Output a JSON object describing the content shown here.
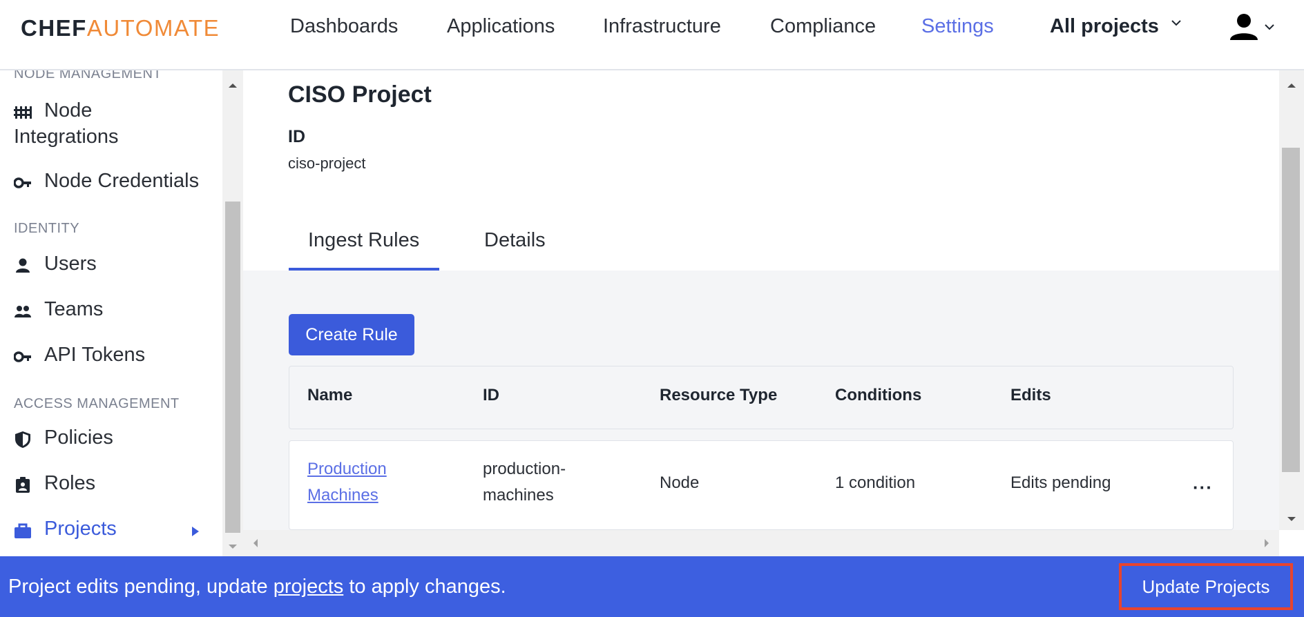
{
  "brand": {
    "part1": "CHEF",
    "part2": "AUTOMATE",
    "accent": "#f08a37"
  },
  "nav": {
    "dashboards": "Dashboards",
    "applications": "Applications",
    "infrastructure": "Infrastructure",
    "compliance": "Compliance",
    "settings": "Settings",
    "active": "Settings",
    "project_filter": "All projects"
  },
  "sidebar": {
    "section_node": "NODE MANAGEMENT",
    "node_integrations": "Node Integrations",
    "node_integrations_l1": "Node",
    "node_integrations_l2": "Integrations",
    "node_credentials": "Node Credentials",
    "section_identity": "IDENTITY",
    "users": "Users",
    "teams": "Teams",
    "api_tokens": "API Tokens",
    "section_access": "ACCESS MANAGEMENT",
    "policies": "Policies",
    "roles": "Roles",
    "projects": "Projects",
    "active": "Projects"
  },
  "project": {
    "title": "CISO Project",
    "id_label": "ID",
    "id_value": "ciso-project"
  },
  "tabs": {
    "ingest_rules": "Ingest Rules",
    "details": "Details",
    "active": "Ingest Rules"
  },
  "create_rule_label": "Create Rule",
  "table": {
    "headers": [
      "Name",
      "ID",
      "Resource Type",
      "Conditions",
      "Edits"
    ],
    "rows": [
      {
        "name_l1": "Production",
        "name_l2": "Machines",
        "id_l1": "production-",
        "id_l2": "machines",
        "resource_type": "Node",
        "conditions": "1 condition",
        "edits": "Edits pending",
        "menu": "···"
      }
    ]
  },
  "banner": {
    "pre": "Project edits pending, update ",
    "link": "projects",
    "post": " to apply changes.",
    "button": "Update Projects"
  },
  "colors": {
    "primary": "#3b5bdb",
    "banner": "#3d5fe0",
    "highlight": "#e8442e"
  }
}
